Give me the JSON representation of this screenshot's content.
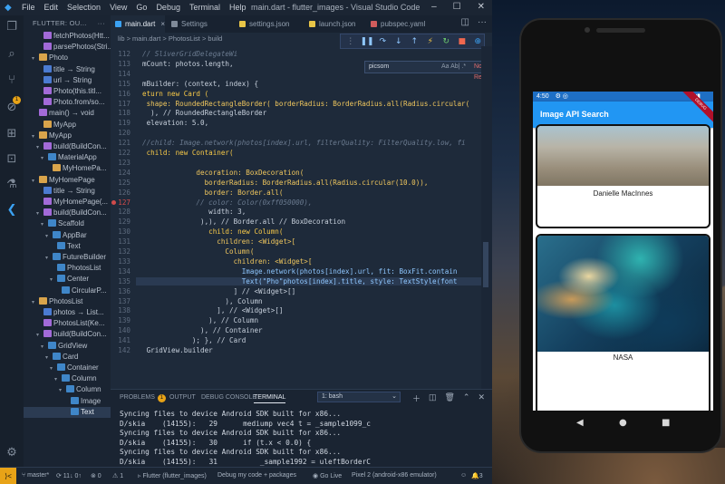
{
  "vscode": {
    "window_title": "main.dart - flutter_images - Visual Studio Code",
    "menu": [
      "File",
      "Edit",
      "Selection",
      "View",
      "Go",
      "Debug",
      "Terminal",
      "Help"
    ],
    "activity_badge": "1",
    "outline_header": "FLUTTER: OU...",
    "outline": [
      {
        "label": "fetchPhotos(Htt...",
        "indent": 2,
        "icon": "fn",
        "twisty": ""
      },
      {
        "label": "parsePhotos(Stri...",
        "indent": 2,
        "icon": "fn",
        "twisty": ""
      },
      {
        "label": "Photo",
        "indent": 1,
        "icon": "cls",
        "twisty": "v"
      },
      {
        "label": "title → String",
        "indent": 2,
        "icon": "sym",
        "twisty": ""
      },
      {
        "label": "url → String",
        "indent": 2,
        "icon": "sym",
        "twisty": ""
      },
      {
        "label": "Photo(this.titl...",
        "indent": 2,
        "icon": "fn",
        "twisty": ""
      },
      {
        "label": "Photo.from/so...",
        "indent": 2,
        "icon": "fn",
        "twisty": ""
      },
      {
        "label": "main() → void",
        "indent": 1,
        "icon": "fn",
        "twisty": ""
      },
      {
        "label": "MyApp",
        "indent": 2,
        "icon": "cls",
        "twisty": ""
      },
      {
        "label": "MyApp",
        "indent": 1,
        "icon": "cls",
        "twisty": "v"
      },
      {
        "label": "build(BuildCon...",
        "indent": 2,
        "icon": "fn",
        "twisty": "v"
      },
      {
        "label": "MaterialApp",
        "indent": 3,
        "icon": "blue",
        "twisty": "v"
      },
      {
        "label": "MyHomePa...",
        "indent": 4,
        "icon": "cls",
        "twisty": ""
      },
      {
        "label": "MyHomePage",
        "indent": 1,
        "icon": "cls",
        "twisty": "v"
      },
      {
        "label": "title → String",
        "indent": 2,
        "icon": "sym",
        "twisty": ""
      },
      {
        "label": "MyHomePage(...",
        "indent": 2,
        "icon": "fn",
        "twisty": ""
      },
      {
        "label": "build(BuildCon...",
        "indent": 2,
        "icon": "fn",
        "twisty": "v"
      },
      {
        "label": "Scaffold",
        "indent": 3,
        "icon": "blue",
        "twisty": "v"
      },
      {
        "label": "AppBar",
        "indent": 4,
        "icon": "blue",
        "twisty": "v"
      },
      {
        "label": "Text",
        "indent": 5,
        "icon": "blue",
        "twisty": ""
      },
      {
        "label": "FutureBuilder",
        "indent": 4,
        "icon": "blue",
        "twisty": "v"
      },
      {
        "label": "PhotosList",
        "indent": 5,
        "icon": "blue",
        "twisty": ""
      },
      {
        "label": "Center",
        "indent": 5,
        "icon": "blue",
        "twisty": "v"
      },
      {
        "label": "CircularP...",
        "indent": 6,
        "icon": "blue",
        "twisty": ""
      },
      {
        "label": "PhotosList",
        "indent": 1,
        "icon": "cls",
        "twisty": "v"
      },
      {
        "label": "photos → List...",
        "indent": 2,
        "icon": "sym",
        "twisty": ""
      },
      {
        "label": "PhotosList(Ke...",
        "indent": 2,
        "icon": "fn",
        "twisty": ""
      },
      {
        "label": "build(BuildCon...",
        "indent": 2,
        "icon": "fn",
        "twisty": "v"
      },
      {
        "label": "GridView",
        "indent": 3,
        "icon": "blue",
        "twisty": "v"
      },
      {
        "label": "Card",
        "indent": 4,
        "icon": "blue",
        "twisty": "v"
      },
      {
        "label": "Container",
        "indent": 5,
        "icon": "blue",
        "twisty": "v"
      },
      {
        "label": "Column",
        "indent": 6,
        "icon": "blue",
        "twisty": "v"
      },
      {
        "label": "Column",
        "indent": 7,
        "icon": "blue",
        "twisty": "v"
      },
      {
        "label": "Image",
        "indent": 8,
        "icon": "blue",
        "twisty": ""
      },
      {
        "label": "Text",
        "indent": 8,
        "icon": "blue",
        "twisty": "",
        "selected": true
      }
    ],
    "tabs": [
      {
        "label": "main.dart",
        "active": true,
        "color": "#3ba2f3"
      },
      {
        "label": "Settings",
        "active": false,
        "color": "#7f8a99"
      },
      {
        "label": "settings.json",
        "active": false,
        "color": "#e8c547"
      },
      {
        "label": "launch.json",
        "active": false,
        "color": "#e8c547"
      },
      {
        "label": "pubspec.yaml",
        "active": false,
        "color": "#d05c5c"
      }
    ],
    "breadcrumbs": "lib  >  main.dart  >  PhotosList  >  build",
    "find": {
      "value": "picsom",
      "options": "Aa  Ab|  .*",
      "result": "No Results"
    },
    "code": [
      {
        "n": "112",
        "t": "// SliverGridDelegateWi",
        "c": "cm"
      },
      {
        "n": "113",
        "t": "mCount: photos.length,",
        "c": ""
      },
      {
        "n": "114",
        "t": "",
        "c": ""
      },
      {
        "n": "115",
        "t": "mBuilder: (context, index) {",
        "c": ""
      },
      {
        "n": "116",
        "t": "eturn new Card (",
        "c": "kw"
      },
      {
        "n": "117",
        "t": " shape: RoundedRectangleBorder( borderRadius: BorderRadius.all(Radius.circular(",
        "c": "ty"
      },
      {
        "n": "118",
        "t": "  ), // RoundedRectangleBorder",
        "c": ""
      },
      {
        "n": "119",
        "t": " elevation: 5.0,",
        "c": ""
      },
      {
        "n": "120",
        "t": "",
        "c": ""
      },
      {
        "n": "121",
        "t": "//child: Image.network(photos[index].url, filterQuality: FilterQuality.low, fi",
        "c": "cm"
      },
      {
        "n": "122",
        "t": " child: new Container(",
        "c": "kw"
      },
      {
        "n": "123",
        "t": "",
        "c": ""
      },
      {
        "n": "124",
        "t": "             decoration: BoxDecoration(",
        "c": "ty"
      },
      {
        "n": "125",
        "t": "               borderRadius: BorderRadius.all(Radius.circular(10.0)),",
        "c": "ty"
      },
      {
        "n": "126",
        "t": "               border: Border.all(",
        "c": "ty"
      },
      {
        "n": "127",
        "t": "             // color: Color(0xff050000),",
        "c": "cm",
        "bp": true
      },
      {
        "n": "128",
        "t": "                width: 3,",
        "c": ""
      },
      {
        "n": "129",
        "t": "              ),), // Border.all // BoxDecoration",
        "c": ""
      },
      {
        "n": "130",
        "t": "                child: new Column(",
        "c": "kw"
      },
      {
        "n": "131",
        "t": "                  children: <Widget>[",
        "c": "ty"
      },
      {
        "n": "132",
        "t": "                    Column(",
        "c": "ty"
      },
      {
        "n": "133",
        "t": "                      children: <Widget>[",
        "c": "ty"
      },
      {
        "n": "134",
        "t": "                        Image.network(photos[index].url, fit: BoxFit.contain",
        "c": "fn"
      },
      {
        "n": "135",
        "t": "                        Text(\"Pho\"photos[index].title, style: TextStyle(font",
        "c": "fn",
        "hl": true
      },
      {
        "n": "136",
        "t": "                      ] // <Widget>[]",
        "c": ""
      },
      {
        "n": "137",
        "t": "                    ), Column",
        "c": ""
      },
      {
        "n": "138",
        "t": "                  ], // <Widget>[]",
        "c": ""
      },
      {
        "n": "139",
        "t": "                ), // Column",
        "c": ""
      },
      {
        "n": "140",
        "t": "              ), // Container",
        "c": ""
      },
      {
        "n": "141",
        "t": "            ); }, // Card",
        "c": ""
      },
      {
        "n": "142",
        "t": " GridView.builder",
        "c": ""
      }
    ],
    "panel": {
      "tabs": [
        "PROBLEMS",
        "OUTPUT",
        "DEBUG CONSOLE",
        "TERMINAL"
      ],
      "problems_badge": "1",
      "terminal_select": "1: bash",
      "lines": [
        "Syncing files to device Android SDK built for x86...",
        "D/skia    (14155):   29      mediump vec4 t = _sample1099_c",
        "Syncing files to device Android SDK built for x86...",
        "D/skia    (14155):   30      if (t.x < 0.0) {",
        "Syncing files to device Android SDK built for x86...",
        "D/skia    (14155):   31          _sample1992 = uleftBorderC"
      ]
    },
    "statusbar": {
      "remote": "⟩<",
      "branch": "master*",
      "sync": "⟳ 11↓ 0↑",
      "errors": "⊗ 0",
      "warnings": "⚠ 1",
      "flutter": "Flutter (flutter_images)",
      "debug": "Debug my code + packages",
      "golive": "Go Live",
      "device": "Pixel 2 (android-x86 emulator)",
      "notifications": "3"
    }
  },
  "emulator": {
    "status_time": "4:50",
    "debug_ribbon": "DEBUG",
    "app_title": "Image API Search",
    "cards": [
      {
        "caption": "Danielle MacInnes"
      },
      {
        "caption": "NASA"
      }
    ]
  }
}
